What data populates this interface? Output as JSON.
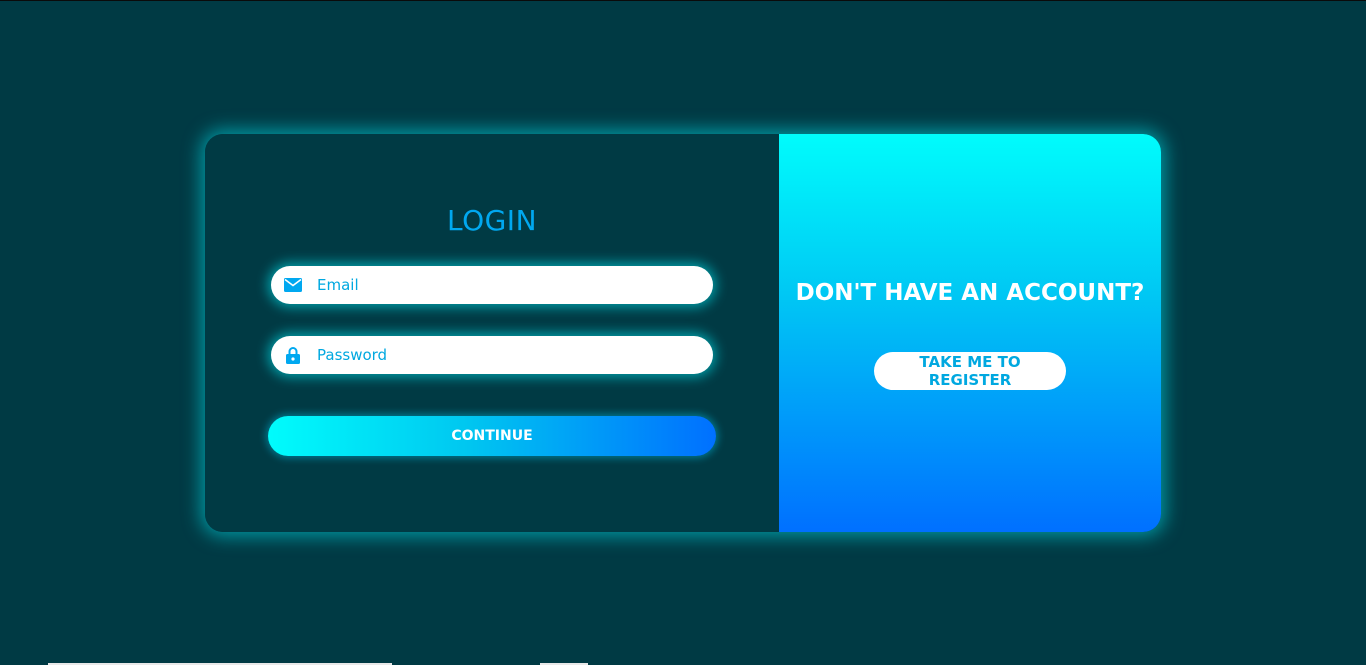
{
  "login": {
    "title": "LOGIN",
    "email_placeholder": "Email",
    "password_placeholder": "Password",
    "continue_label": "CONTINUE",
    "email_icon": "mail-icon",
    "password_icon": "lock-icon"
  },
  "register_panel": {
    "heading": "DON'T HAVE AN ACCOUNT?",
    "button_label": "TAKE ME TO REGISTER"
  },
  "colors": {
    "background": "#003a44",
    "accent": "#00a8f0",
    "glow": "#00e6f0",
    "gradient_start": "#00fcfc",
    "gradient_end": "#0070ff",
    "text_on_gradient": "#ffffff"
  }
}
